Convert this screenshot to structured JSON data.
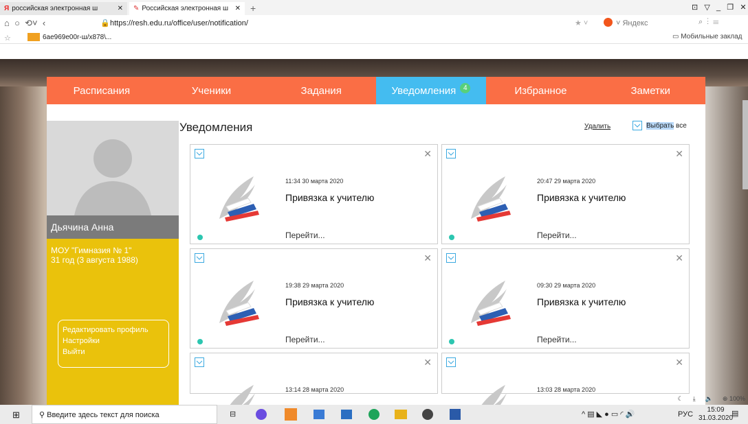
{
  "browser": {
    "tabs": [
      {
        "label": "российская электронная ш"
      },
      {
        "label": "Российская электронная ш"
      }
    ],
    "url": "https://resh.edu.ru/office/user/notification/",
    "search_engine": "Яндекс",
    "bookmark": "6ae969e00r-ш/x878\\...",
    "mobile_bookmarks": "Мобильные заклад"
  },
  "nav": {
    "items": [
      "Расписания",
      "Ученики",
      "Задания",
      "Уведомления",
      "Избранное",
      "Заметки"
    ],
    "badge": "4"
  },
  "profile": {
    "name": "Дьячина Анна",
    "school": "МОУ \"Гимназия № 1\"",
    "age": "31 год (3 августа 1988)",
    "links": [
      "Редактировать профиль",
      "Настройки",
      "Выйти"
    ]
  },
  "main": {
    "title": "Уведомления",
    "delete": "Удалить",
    "select_all_hl": "Выбрать",
    "select_all_rest": " все"
  },
  "notifications": [
    {
      "time": "11:34 30 марта 2020",
      "title": "Привязка к учителю",
      "go": "Перейти..."
    },
    {
      "time": "20:47 29 марта 2020",
      "title": "Привязка к учителю",
      "go": "Перейти..."
    },
    {
      "time": "19:38 29 марта 2020",
      "title": "Привязка к учителю",
      "go": "Перейти..."
    },
    {
      "time": "09:30 29 марта 2020",
      "title": "Привязка к учителю",
      "go": "Перейти..."
    },
    {
      "time": "13:14 28 марта 2020",
      "title": "",
      "go": ""
    },
    {
      "time": "13:03 28 марта 2020",
      "title": "",
      "go": ""
    }
  ],
  "zoom": "100%",
  "taskbar": {
    "search": "Введите здесь текст для поиска",
    "lang": "РУС",
    "time": "15:09",
    "date": "31.03.2020"
  }
}
